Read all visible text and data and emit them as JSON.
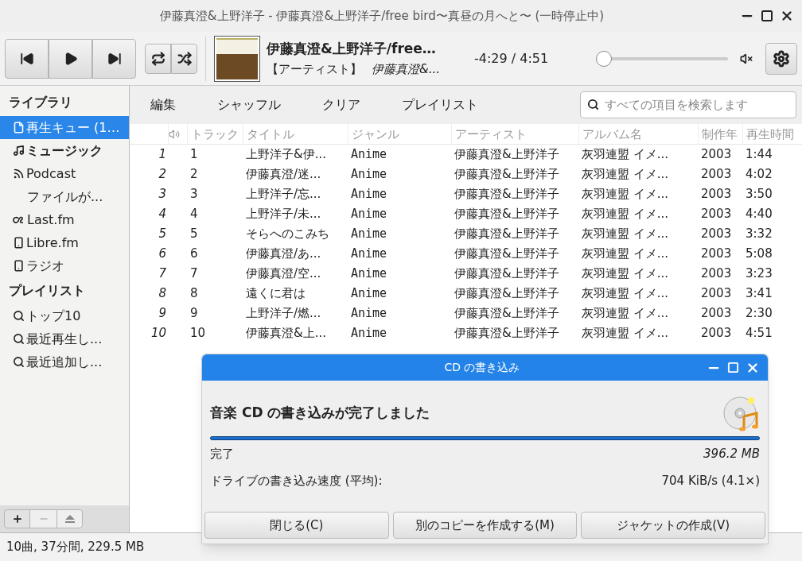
{
  "window": {
    "title": "伊藤真澄&上野洋子 - 伊藤真澄&上野洋子/free bird〜真昼の月へと〜 (一時停止中)"
  },
  "now_playing": {
    "title": "伊藤真澄&上野洋子/free…",
    "artist_label": "【アーティスト】",
    "artist": "伊藤真澄&...",
    "time": "-4:29 / 4:51",
    "seek": {
      "level": 0.02
    },
    "muted": true
  },
  "sidebar": {
    "sections": [
      {
        "heading": "ライブラリ",
        "items": [
          {
            "label": "再生キュー (1…",
            "kind": "item",
            "selected": true
          },
          {
            "label": "ミュージック",
            "kind": "category",
            "selected": false
          },
          {
            "label": "Podcast",
            "kind": "item",
            "selected": false
          },
          {
            "label": "ファイルが...",
            "kind": "subitem",
            "selected": false
          },
          {
            "label": "Last.fm",
            "kind": "item",
            "selected": false
          },
          {
            "label": "Libre.fm",
            "kind": "item",
            "selected": false
          },
          {
            "label": "ラジオ",
            "kind": "item",
            "selected": false
          }
        ]
      },
      {
        "heading": "プレイリスト",
        "items": [
          {
            "label": "トップ10",
            "kind": "item",
            "selected": false
          },
          {
            "label": "最近再生し...",
            "kind": "item",
            "selected": false
          },
          {
            "label": "最近追加し...",
            "kind": "item",
            "selected": false
          }
        ]
      }
    ]
  },
  "toolbar": {
    "buttons": [
      "編集",
      "シャッフル",
      "クリア",
      "プレイリスト"
    ],
    "search": {
      "placeholder": "すべての項目を検索します"
    }
  },
  "table": {
    "columns": [
      "",
      "トラック",
      "タイトル",
      "ジャンル",
      "アーティスト",
      "アルバム名",
      "制作年",
      "再生時間"
    ],
    "rows": [
      [
        "1",
        "1",
        "上野洋子&伊...",
        "Anime",
        "伊藤真澄&上野洋子",
        "灰羽連盟 イメ...",
        "2003",
        "1:44"
      ],
      [
        "2",
        "2",
        "伊藤真澄/迷...",
        "Anime",
        "伊藤真澄&上野洋子",
        "灰羽連盟 イメ...",
        "2003",
        "4:02"
      ],
      [
        "3",
        "3",
        "上野洋子/忘...",
        "Anime",
        "伊藤真澄&上野洋子",
        "灰羽連盟 イメ...",
        "2003",
        "3:50"
      ],
      [
        "4",
        "4",
        "上野洋子/未...",
        "Anime",
        "伊藤真澄&上野洋子",
        "灰羽連盟 イメ...",
        "2003",
        "4:40"
      ],
      [
        "5",
        "5",
        "そらへのこみち",
        "Anime",
        "伊藤真澄&上野洋子",
        "灰羽連盟 イメ...",
        "2003",
        "3:32"
      ],
      [
        "6",
        "6",
        "伊藤真澄/あ...",
        "Anime",
        "伊藤真澄&上野洋子",
        "灰羽連盟 イメ...",
        "2003",
        "5:08"
      ],
      [
        "7",
        "7",
        "伊藤真澄/空...",
        "Anime",
        "伊藤真澄&上野洋子",
        "灰羽連盟 イメ...",
        "2003",
        "3:23"
      ],
      [
        "8",
        "8",
        "遠くに君は",
        "Anime",
        "伊藤真澄&上野洋子",
        "灰羽連盟 イメ...",
        "2003",
        "3:41"
      ],
      [
        "9",
        "9",
        "上野洋子/燃...",
        "Anime",
        "伊藤真澄&上野洋子",
        "灰羽連盟 イメ...",
        "2003",
        "2:30"
      ],
      [
        "10",
        "10",
        "伊藤真澄&上...",
        "Anime",
        "伊藤真澄&上野洋子",
        "灰羽連盟 イメ...",
        "2003",
        "4:51"
      ]
    ]
  },
  "status_bar": "10曲, 37分間, 229.5 MB",
  "dialog": {
    "title": "CD の書き込み",
    "heading": "音楽 CD の書き込みが完了しました",
    "progress": {
      "level": 1
    },
    "status": "完了",
    "size": "396.2 MB",
    "speed_label": "ドライブの書き込み速度 (平均):",
    "speed": "704 KiB/s (4.1×)",
    "buttons": [
      "閉じる(C)",
      "別のコピーを作成する(M)",
      "ジャケットの作成(V)"
    ]
  }
}
